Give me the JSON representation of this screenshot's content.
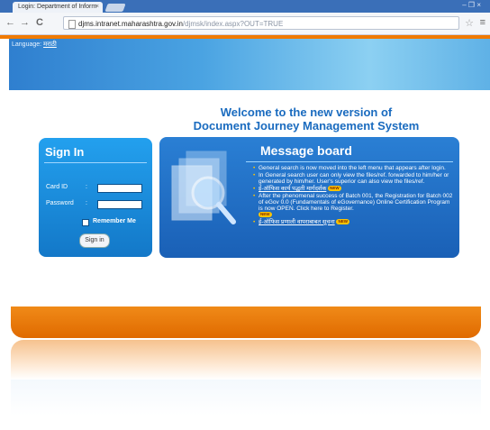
{
  "browser": {
    "tab_title": "Login: Department of Inform",
    "tab_close": "×",
    "url_host": "djms.intranet.maharashtra.gov.in",
    "url_path": "/djmsk/index.aspx?OUT=TRUE",
    "back": "←",
    "forward": "→",
    "reload": "C",
    "star": "☆",
    "menu": "≡",
    "window_controls": "– ❐ ×"
  },
  "header": {
    "language_label": "Language:",
    "language_link": "मराठी"
  },
  "welcome": {
    "line1": "Welcome to the new version of",
    "line2": "Document Journey Management System"
  },
  "signin": {
    "title": "Sign In",
    "card_label": "Card ID",
    "password_label": "Password",
    "colon": ":",
    "card_value": "",
    "password_value": "",
    "remember_label": "Remember Me",
    "button_label": "Sign in"
  },
  "message_board": {
    "title": "Message board",
    "new_badge": "NEW",
    "items": [
      {
        "text": "General search is now moved into the left menu that appears after login."
      },
      {
        "text": "In General search user can only view the files/ref. forwarded to him/her or generated by him/her. User's superior can also view the files/ref."
      },
      {
        "text": "ई-ऑफिस कार्य पद्धती मार्गदर्शक"
      },
      {
        "text": "After the phenomenal success of Batch 001, the Registration for Batch 002 of eGov 0.0 (Fundamentals of eGovernance) Online Certification Program is now OPEN. Click here to Register."
      },
      {
        "text": "ई-ऑफिस प्रणाली वापराबाबत सूचना"
      }
    ]
  },
  "colors": {
    "accent_blue": "#1a6bbf",
    "accent_orange": "#f07a00"
  }
}
